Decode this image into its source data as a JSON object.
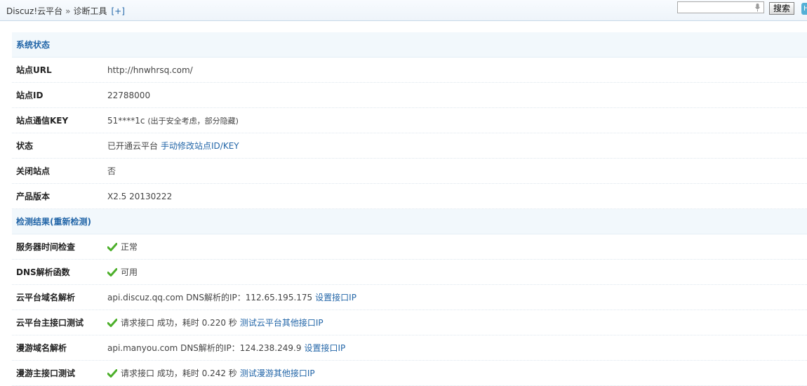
{
  "breadcrumb": {
    "root": "Discuz!云平台",
    "separator": "»",
    "current": "诊断工具",
    "expand": "[+]"
  },
  "search": {
    "placeholder": "",
    "button": "搜索"
  },
  "corner": "H",
  "sections": {
    "system_status": "系统状态",
    "check_results": "检测结果",
    "recheck_open": "(",
    "recheck": "重新检测",
    "recheck_close": ")"
  },
  "rows": {
    "site_url": {
      "label": "站点URL",
      "value": "http://hnwhrsq.com/"
    },
    "site_id": {
      "label": "站点ID",
      "value": "22788000"
    },
    "site_key": {
      "label": "站点通信KEY",
      "value": "51****1c",
      "note": "(出于安全考虑，部分隐藏)"
    },
    "status": {
      "label": "状态",
      "value": "已开通云平台",
      "link": "手动修改站点ID/KEY"
    },
    "site_closed": {
      "label": "关闭站点",
      "value": "否"
    },
    "version": {
      "label": "产品版本",
      "value": "X2.5 20130222"
    },
    "server_time": {
      "label": "服务器时间检查",
      "value": "正常"
    },
    "dns_func": {
      "label": "DNS解析函数",
      "value": "可用"
    },
    "cloud_dns": {
      "label": "云平台域名解析",
      "value": "api.discuz.qq.com DNS解析的IP：112.65.195.175",
      "link": "设置接口IP"
    },
    "cloud_api": {
      "label": "云平台主接口测试",
      "value": "请求接口 成功，耗时 0.220 秒",
      "link": "测试云平台其他接口IP"
    },
    "manyou_dns": {
      "label": "漫游域名解析",
      "value": "api.manyou.com DNS解析的IP：124.238.249.9",
      "link": "设置接口IP"
    },
    "manyou_api": {
      "label": "漫游主接口测试",
      "value": "请求接口 成功，耗时 0.242 秒",
      "link": "测试漫游其他接口IP"
    }
  },
  "colors": {
    "link": "#2366a8",
    "check": "#4caf2a",
    "header_bg": "#f2f8fc"
  },
  "icons": {
    "check": "check-icon",
    "mic": "microphone-icon"
  }
}
